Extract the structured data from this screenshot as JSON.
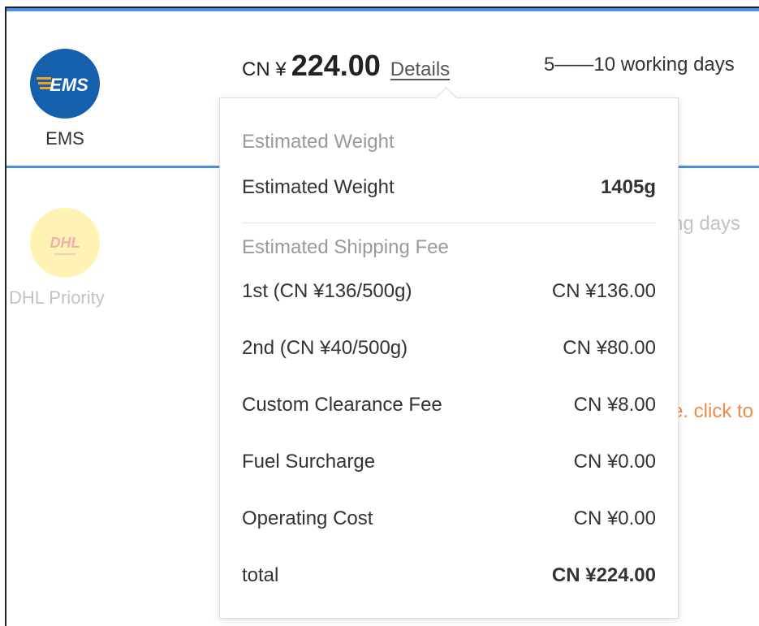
{
  "carriers": [
    {
      "name": "EMS",
      "logo_text": "EMS",
      "logo_color": "#1460ad",
      "icon": "ems-logo-icon"
    },
    {
      "name": "DHL Priority",
      "logo_text": "DHL",
      "logo_color": "#fff2a8",
      "icon": "dhl-logo-icon"
    }
  ],
  "ems": {
    "currency_prefix": "CN ¥",
    "price": "224.00",
    "details_label": "Details",
    "delivery_time": "5——10 working days"
  },
  "dhl": {
    "delivery_time_partial": "ng days",
    "note_partial": "e. click to"
  },
  "popover": {
    "weight_section_title": "Estimated Weight",
    "weight_row": {
      "label": "Estimated Weight",
      "value": "1405g"
    },
    "fee_section_title": "Estimated Shipping Fee",
    "fee_rows": [
      {
        "label": "1st (CN ¥136/500g)",
        "value": "CN ¥136.00"
      },
      {
        "label": "2nd (CN ¥40/500g)",
        "value": "CN ¥80.00"
      },
      {
        "label": "Custom Clearance Fee",
        "value": "CN ¥8.00"
      },
      {
        "label": "Fuel Surcharge",
        "value": "CN ¥0.00"
      },
      {
        "label": "Operating Cost",
        "value": "CN ¥0.00"
      },
      {
        "label": "total",
        "value": "CN ¥224.00"
      }
    ]
  },
  "colors": {
    "accent_line": "#4a8fe2",
    "note_orange": "#f08a4b",
    "muted_text": "#c2c2c2"
  }
}
